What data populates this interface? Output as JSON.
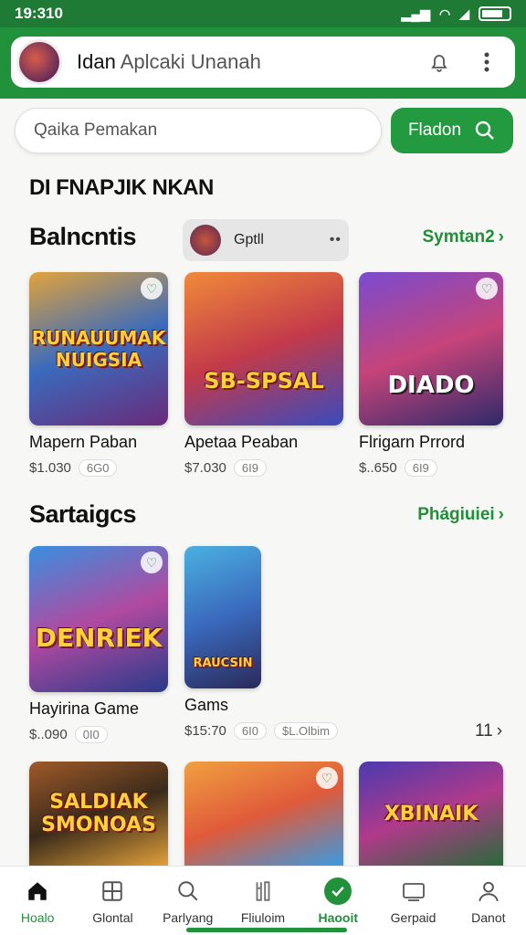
{
  "status_bar": {
    "time": "19:310"
  },
  "header": {
    "title_strong": "Idan",
    "title_light": "Aplcaki Unanah"
  },
  "search": {
    "placeholder": "Qaika Pemakan",
    "button_label": "Fladon"
  },
  "page_heading": "DI FNAPJIK NKAN",
  "section1": {
    "title": "Balncntis",
    "chip_label": "Gptll",
    "chip_more": "••",
    "see_all": "Symtan2",
    "cards": [
      {
        "thumb_text": "RUNAUUMAK NUIGSIA",
        "name": "Mapern Paban",
        "price": "$1.030",
        "badge": "6G0",
        "colors": [
          "#e2a33a",
          "#3a6bbd",
          "#6b2a7a"
        ]
      },
      {
        "thumb_text": "SB-SPSAL",
        "name": "Apetaa Peaban",
        "price": "$7.030",
        "badge": "6I9",
        "colors": [
          "#f08a3a",
          "#c33a4a",
          "#3a4bbd"
        ]
      },
      {
        "thumb_text": "DIADO",
        "name": "Flrigarn Prrord",
        "price": "$..650",
        "badge": "6I9",
        "colors": [
          "#7a4bd0",
          "#c6447a",
          "#2f2a6a"
        ]
      }
    ]
  },
  "section2": {
    "title": "Sartaigcs",
    "see_all": "Phágiuiei",
    "pagination": "11",
    "cards": [
      {
        "thumb_text": "DENRIEK",
        "name": "Hayirina Game",
        "price": "$..090",
        "badge": "0I0",
        "colors": [
          "#3a8fe0",
          "#b04aa0",
          "#2a3a8a"
        ]
      },
      {
        "thumb_text": "RAUCSIN",
        "name": "Gams",
        "price": "$15:70",
        "badge": "6I0",
        "badge2": "$L.Olbim",
        "colors": [
          "#4ab0e0",
          "#3a6abd",
          "#2a2a5a"
        ]
      }
    ]
  },
  "section3": {
    "cards": [
      {
        "thumb_text": "SALDIAK SMONOAS",
        "colors": [
          "#a05a2a",
          "#3a2a1a",
          "#e0a03a"
        ]
      },
      {
        "thumb_text": "",
        "colors": [
          "#f0a040",
          "#e05a3a",
          "#3a9ae0"
        ]
      },
      {
        "thumb_text": "XBINAIK",
        "colors": [
          "#4a3ab0",
          "#b03a8a",
          "#2a6a3a"
        ]
      }
    ]
  },
  "bottom_nav": [
    {
      "label": "Hoalo",
      "icon": "home-icon"
    },
    {
      "label": "Glontal",
      "icon": "grid-icon"
    },
    {
      "label": "Parlyang",
      "icon": "search-icon"
    },
    {
      "label": "Fliuloim",
      "icon": "puzzle-icon"
    },
    {
      "label": "Haooit",
      "icon": "check-icon"
    },
    {
      "label": "Gerpaid",
      "icon": "cast-icon"
    },
    {
      "label": "Danot",
      "icon": "person-icon"
    }
  ]
}
